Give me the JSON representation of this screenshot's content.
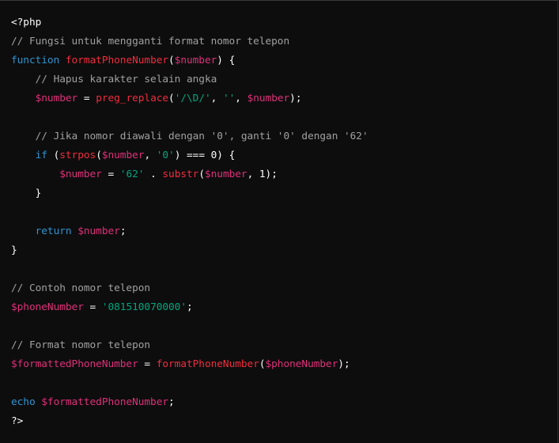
{
  "language": "php",
  "colors": {
    "background": "#0d0d0d",
    "plain": "#ffffff",
    "comment": "#a0a0a0",
    "keyword": "#2e95d3",
    "function": "#f22c3d",
    "variable": "#df3079",
    "string": "#00a67d"
  },
  "code_lines": [
    [
      {
        "t": "meta",
        "v": "<?php"
      }
    ],
    [
      {
        "t": "comment",
        "v": "// Fungsi untuk mengganti format nomor telepon"
      }
    ],
    [
      {
        "t": "keyword",
        "v": "function"
      },
      {
        "t": "plain",
        "v": " "
      },
      {
        "t": "func",
        "v": "formatPhoneNumber"
      },
      {
        "t": "plain",
        "v": "("
      },
      {
        "t": "var",
        "v": "$number"
      },
      {
        "t": "plain",
        "v": ") {"
      }
    ],
    [
      {
        "t": "plain",
        "v": "    "
      },
      {
        "t": "comment",
        "v": "// Hapus karakter selain angka"
      }
    ],
    [
      {
        "t": "plain",
        "v": "    "
      },
      {
        "t": "var",
        "v": "$number"
      },
      {
        "t": "plain",
        "v": " = "
      },
      {
        "t": "func",
        "v": "preg_replace"
      },
      {
        "t": "plain",
        "v": "("
      },
      {
        "t": "string",
        "v": "'/\\D/'"
      },
      {
        "t": "plain",
        "v": ", "
      },
      {
        "t": "string",
        "v": "''"
      },
      {
        "t": "plain",
        "v": ", "
      },
      {
        "t": "var",
        "v": "$number"
      },
      {
        "t": "plain",
        "v": ");"
      }
    ],
    [],
    [
      {
        "t": "plain",
        "v": "    "
      },
      {
        "t": "comment",
        "v": "// Jika nomor diawali dengan '0', ganti '0' dengan '62'"
      }
    ],
    [
      {
        "t": "plain",
        "v": "    "
      },
      {
        "t": "keyword",
        "v": "if"
      },
      {
        "t": "plain",
        "v": " ("
      },
      {
        "t": "func",
        "v": "strpos"
      },
      {
        "t": "plain",
        "v": "("
      },
      {
        "t": "var",
        "v": "$number"
      },
      {
        "t": "plain",
        "v": ", "
      },
      {
        "t": "string",
        "v": "'0'"
      },
      {
        "t": "plain",
        "v": ") === 0) {"
      }
    ],
    [
      {
        "t": "plain",
        "v": "        "
      },
      {
        "t": "var",
        "v": "$number"
      },
      {
        "t": "plain",
        "v": " = "
      },
      {
        "t": "string",
        "v": "'62'"
      },
      {
        "t": "plain",
        "v": " . "
      },
      {
        "t": "func",
        "v": "substr"
      },
      {
        "t": "plain",
        "v": "("
      },
      {
        "t": "var",
        "v": "$number"
      },
      {
        "t": "plain",
        "v": ", 1);"
      }
    ],
    [
      {
        "t": "plain",
        "v": "    }"
      }
    ],
    [],
    [
      {
        "t": "plain",
        "v": "    "
      },
      {
        "t": "keyword",
        "v": "return"
      },
      {
        "t": "plain",
        "v": " "
      },
      {
        "t": "var",
        "v": "$number"
      },
      {
        "t": "plain",
        "v": ";"
      }
    ],
    [
      {
        "t": "plain",
        "v": "}"
      }
    ],
    [],
    [
      {
        "t": "comment",
        "v": "// Contoh nomor telepon"
      }
    ],
    [
      {
        "t": "var",
        "v": "$phoneNumber"
      },
      {
        "t": "plain",
        "v": " = "
      },
      {
        "t": "string",
        "v": "'081510070000'"
      },
      {
        "t": "plain",
        "v": ";"
      }
    ],
    [],
    [
      {
        "t": "comment",
        "v": "// Format nomor telepon"
      }
    ],
    [
      {
        "t": "var",
        "v": "$formattedPhoneNumber"
      },
      {
        "t": "plain",
        "v": " = "
      },
      {
        "t": "func",
        "v": "formatPhoneNumber"
      },
      {
        "t": "plain",
        "v": "("
      },
      {
        "t": "var",
        "v": "$phoneNumber"
      },
      {
        "t": "plain",
        "v": ");"
      }
    ],
    [],
    [
      {
        "t": "keyword",
        "v": "echo"
      },
      {
        "t": "plain",
        "v": " "
      },
      {
        "t": "var",
        "v": "$formattedPhoneNumber"
      },
      {
        "t": "plain",
        "v": ";"
      }
    ],
    [
      {
        "t": "meta",
        "v": "?>"
      }
    ]
  ]
}
